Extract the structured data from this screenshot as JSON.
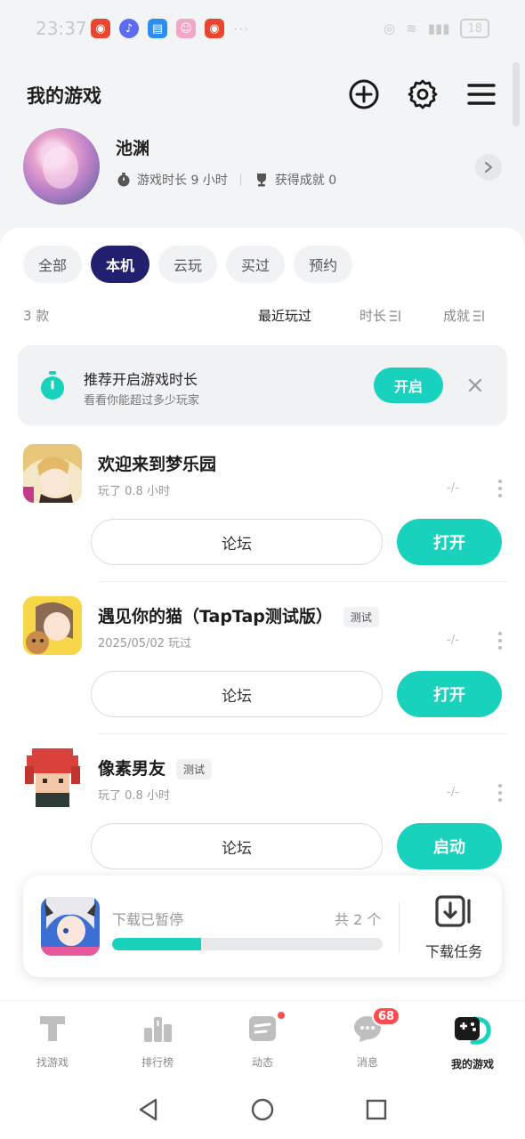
{
  "status_bar": {
    "time": "23:37",
    "battery": "18"
  },
  "header": {
    "title": "我的游戏"
  },
  "profile": {
    "name": "池渊",
    "playtime": "游戏时长 9 小时",
    "achievements": "获得成就 0"
  },
  "filters": [
    "全部",
    "本机",
    "云玩",
    "买过",
    "预约"
  ],
  "list_header": {
    "count": "3 款",
    "sort_recent": "最近玩过",
    "sort_time": "时长",
    "sort_achievement": "成就"
  },
  "banner": {
    "title": "推荐开启游戏时长",
    "subtitle": "看看你能超过多少玩家",
    "button": "开启"
  },
  "games": [
    {
      "name": "欢迎来到梦乐园",
      "tag": "",
      "meta": "玩了 0.8 小时",
      "dash": "-/-",
      "forum": "论坛",
      "action": "打开"
    },
    {
      "name": "遇见你的猫（TapTap测试版）",
      "tag": "测试",
      "meta": "2025/05/02 玩过",
      "dash": "-/-",
      "forum": "论坛",
      "action": "打开"
    },
    {
      "name": "像素男友",
      "tag": "测试",
      "meta": "玩了 0.8 小时",
      "dash": "-/-",
      "forum": "论坛",
      "action": "启动"
    }
  ],
  "download": {
    "status": "下载已暂停",
    "total": "共 2 个",
    "progress": 0.33,
    "tasks_label": "下载任务"
  },
  "bottom_nav": [
    {
      "label": "找游戏",
      "icon": "taptap-icon"
    },
    {
      "label": "排行榜",
      "icon": "ranking-icon"
    },
    {
      "label": "动态",
      "icon": "feed-icon"
    },
    {
      "label": "消息",
      "icon": "message-icon",
      "badge": "68"
    },
    {
      "label": "我的游戏",
      "icon": "my-games-icon"
    }
  ],
  "colors": {
    "accent": "#19d2be",
    "active_chip": "#221f6f",
    "badge": "#ff4d4f"
  }
}
